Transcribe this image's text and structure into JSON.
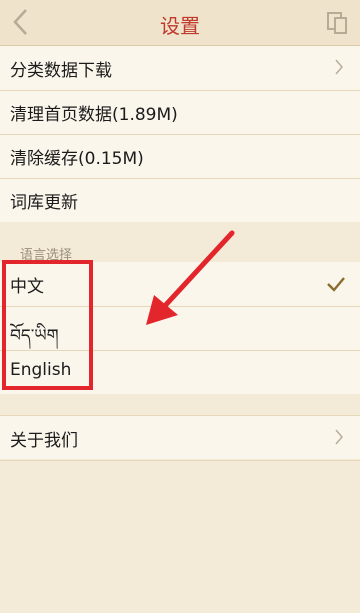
{
  "header": {
    "title": "设置",
    "back_icon": "chevron-left-icon",
    "action_icon": "copy-icon"
  },
  "settings": {
    "items": [
      {
        "label": "分类数据下载",
        "has_chevron": true
      },
      {
        "label": "清理首页数据(1.89M)"
      },
      {
        "label": "清除缓存(0.15M)"
      },
      {
        "label": "词库更新"
      }
    ]
  },
  "language": {
    "section_label": "语言选择",
    "options": [
      {
        "label": "中文",
        "selected": true
      },
      {
        "label": "བོད་ཡིག"
      },
      {
        "label": "English"
      }
    ]
  },
  "about": {
    "label": "关于我们",
    "has_chevron": true
  },
  "colors": {
    "accent": "#c0392b",
    "annotation": "#e3262b",
    "check": "#8a6d2e",
    "background": "#f3ead7"
  }
}
